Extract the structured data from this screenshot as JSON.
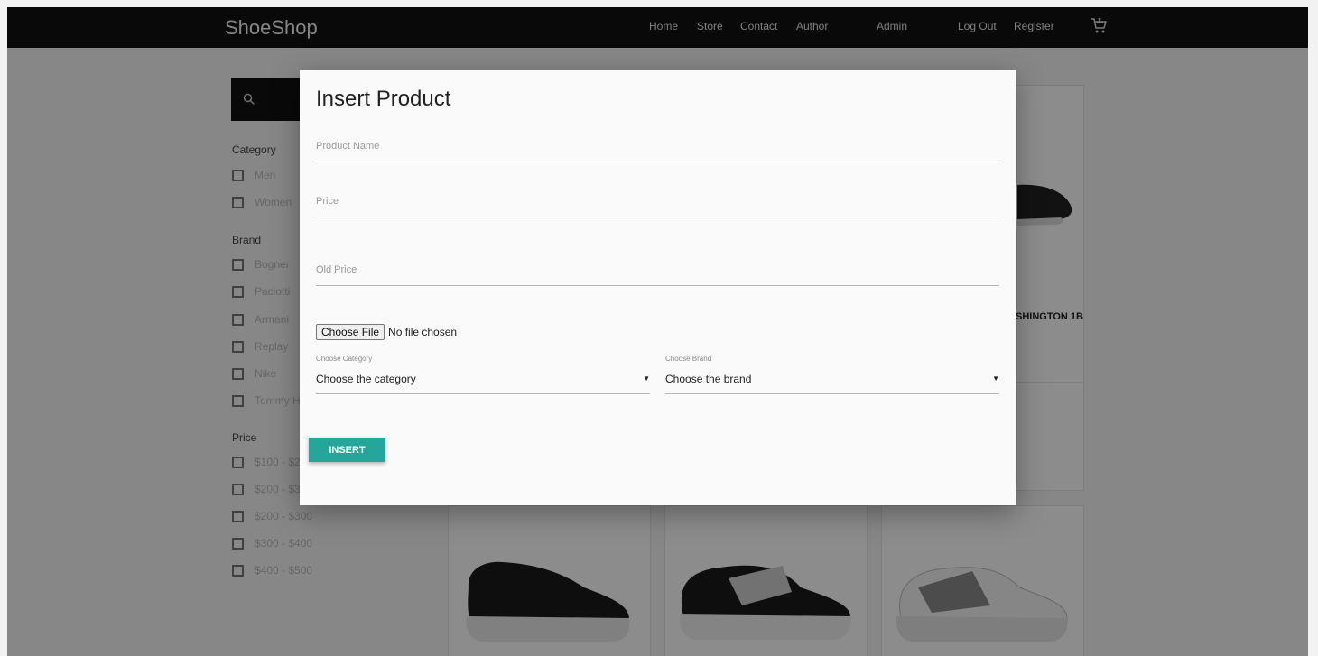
{
  "navbar": {
    "brand": "ShoeShop",
    "links": [
      "Home",
      "Store",
      "Contact",
      "Author",
      "Admin",
      "Log Out",
      "Register"
    ],
    "cart_icon": "cart-icon"
  },
  "filters": {
    "category_title": "Category",
    "categories": [
      "Men",
      "Women"
    ],
    "brand_title": "Brand",
    "brands": [
      "Bogner",
      "Paciotti",
      "Armani",
      "Replay",
      "Nike",
      "Tommy H"
    ],
    "price_title": "Price",
    "prices": [
      "$100 - $2",
      "$200 - $3",
      "$200 - $300",
      "$300 - $400",
      "$400 - $500"
    ]
  },
  "products": {
    "partial_title": "SHINGTON 1B"
  },
  "modal": {
    "title": "Insert Product",
    "product_name_placeholder": "Product Name",
    "price_placeholder": "Price",
    "old_price_placeholder": "Old Price",
    "file_button": "Choose File",
    "file_status": "No file chosen",
    "category_label": "Choose Category",
    "category_value": "Choose the category",
    "brand_label": "Choose Brand",
    "brand_value": "Choose the brand",
    "insert_button": "INSERT"
  },
  "colors": {
    "navbar_bg": "#111111",
    "accent": "#26a69a"
  }
}
